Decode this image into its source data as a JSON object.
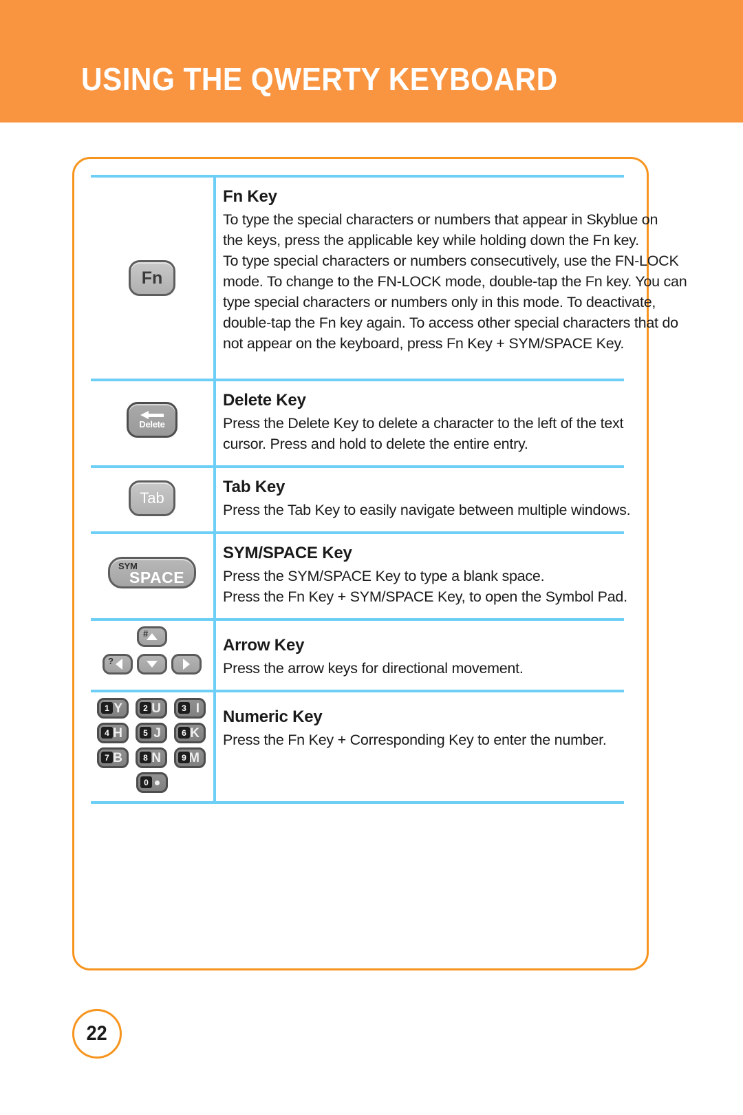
{
  "header": {
    "title": "USING THE QWERTY KEYBOARD",
    "background_color": "#f99441",
    "text_color": "#ffffff"
  },
  "colors": {
    "accent_orange": "#f7941e",
    "rule_blue": "#6ecff6",
    "key_gray": "#b0b0b0",
    "key_dark_gray": "#808080",
    "text": "#1a1a1a"
  },
  "sections": [
    {
      "id": "fn",
      "key_label": "Fn",
      "title": "Fn Key",
      "lines": [
        "To type the special characters or numbers that appear in Skyblue on",
        "the keys, press the applicable key while holding down the Fn key.",
        "To type special characters or numbers consecutively, use the FN-LOCK",
        "mode. To change to the FN-LOCK mode, double-tap the Fn key. You can",
        "type special characters or numbers only in this mode. To deactivate,",
        "double-tap the Fn key again. To access other special characters that do",
        "not appear on the keyboard, press Fn Key + SYM/SPACE Key."
      ]
    },
    {
      "id": "delete",
      "key_label": "Delete",
      "title": "Delete Key",
      "lines": [
        "Press the Delete Key to delete a character to the left of the text",
        "cursor. Press and hold to delete the entire entry."
      ]
    },
    {
      "id": "tab",
      "key_label": "Tab",
      "title": "Tab Key",
      "lines": [
        "Press the Tab Key to easily navigate between multiple windows."
      ]
    },
    {
      "id": "sym_space",
      "key_label_small": "SYM",
      "key_label_big": "SPACE",
      "title": "SYM/SPACE Key",
      "lines": [
        "Press the SYM/SPACE Key to type a blank space.",
        "Press the Fn Key + SYM/SPACE Key, to open the Symbol Pad."
      ]
    },
    {
      "id": "arrow",
      "title": "Arrow Key",
      "lines": [
        "Press the arrow keys for directional movement."
      ],
      "arrow_keys": [
        {
          "direction": "up",
          "alt": "#"
        },
        {
          "direction": "left",
          "alt": "?"
        },
        {
          "direction": "down",
          "alt": ""
        },
        {
          "direction": "right",
          "alt": ""
        }
      ]
    },
    {
      "id": "numeric",
      "title": "Numeric Key",
      "lines": [
        "Press the Fn Key + Corresponding Key to enter the number."
      ],
      "numpad": [
        [
          {
            "num": "1",
            "letter": "Y"
          },
          {
            "num": "2",
            "letter": "U"
          },
          {
            "num": "3",
            "letter": "I"
          }
        ],
        [
          {
            "num": "4",
            "letter": "H"
          },
          {
            "num": "5",
            "letter": "J"
          },
          {
            "num": "6",
            "letter": "K"
          }
        ],
        [
          {
            "num": "7",
            "letter": "B"
          },
          {
            "num": "8",
            "letter": "N"
          },
          {
            "num": "9",
            "letter": "M"
          }
        ],
        [
          {
            "num": "0",
            "letter": "."
          }
        ]
      ]
    }
  ],
  "footer": {
    "page_number": "22"
  }
}
